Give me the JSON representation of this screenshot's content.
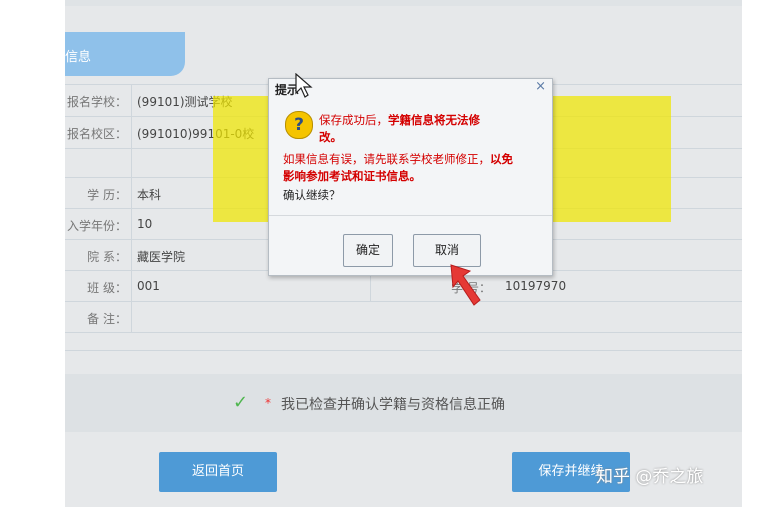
{
  "section": {
    "tab_label": "信息"
  },
  "fields": [
    {
      "label": "报名学校：",
      "value": "(99101)测试学校"
    },
    {
      "label": "报名校区：",
      "value": "(991010)99101-0校"
    },
    {
      "label": "学    历：",
      "value": "本科"
    },
    {
      "label": "入学年份：",
      "value": "10"
    },
    {
      "label": "院    系：",
      "value": "藏医学院"
    },
    {
      "label": "班    级：",
      "value": "001"
    },
    {
      "label": "备    注：",
      "value": ""
    }
  ],
  "student_no": {
    "label": "学    号：",
    "value": "10197970"
  },
  "confirm": {
    "check": "✓",
    "star": "*",
    "text": "我已检查并确认学籍与资格信息正确"
  },
  "buttons": {
    "home": "返回首页",
    "save_continue": "保存并继续"
  },
  "watermark": "知乎 @乔之旅",
  "dialog": {
    "title": "提示",
    "close": "×",
    "icon": "?",
    "line1a": "保存成功后，",
    "line1b": "学籍信息将无法修改。",
    "line2a": "如果信息有误，请先联系学校老师修正，",
    "line2b": "以免影响参加考试和证书信息。",
    "line3": "确认继续？",
    "ok": "确定",
    "cancel": "取消"
  },
  "colors": {
    "highlight": "#f0e600",
    "accent": "#4e9ad6",
    "alert_text": "#d40000",
    "arrow": "#e53935"
  }
}
